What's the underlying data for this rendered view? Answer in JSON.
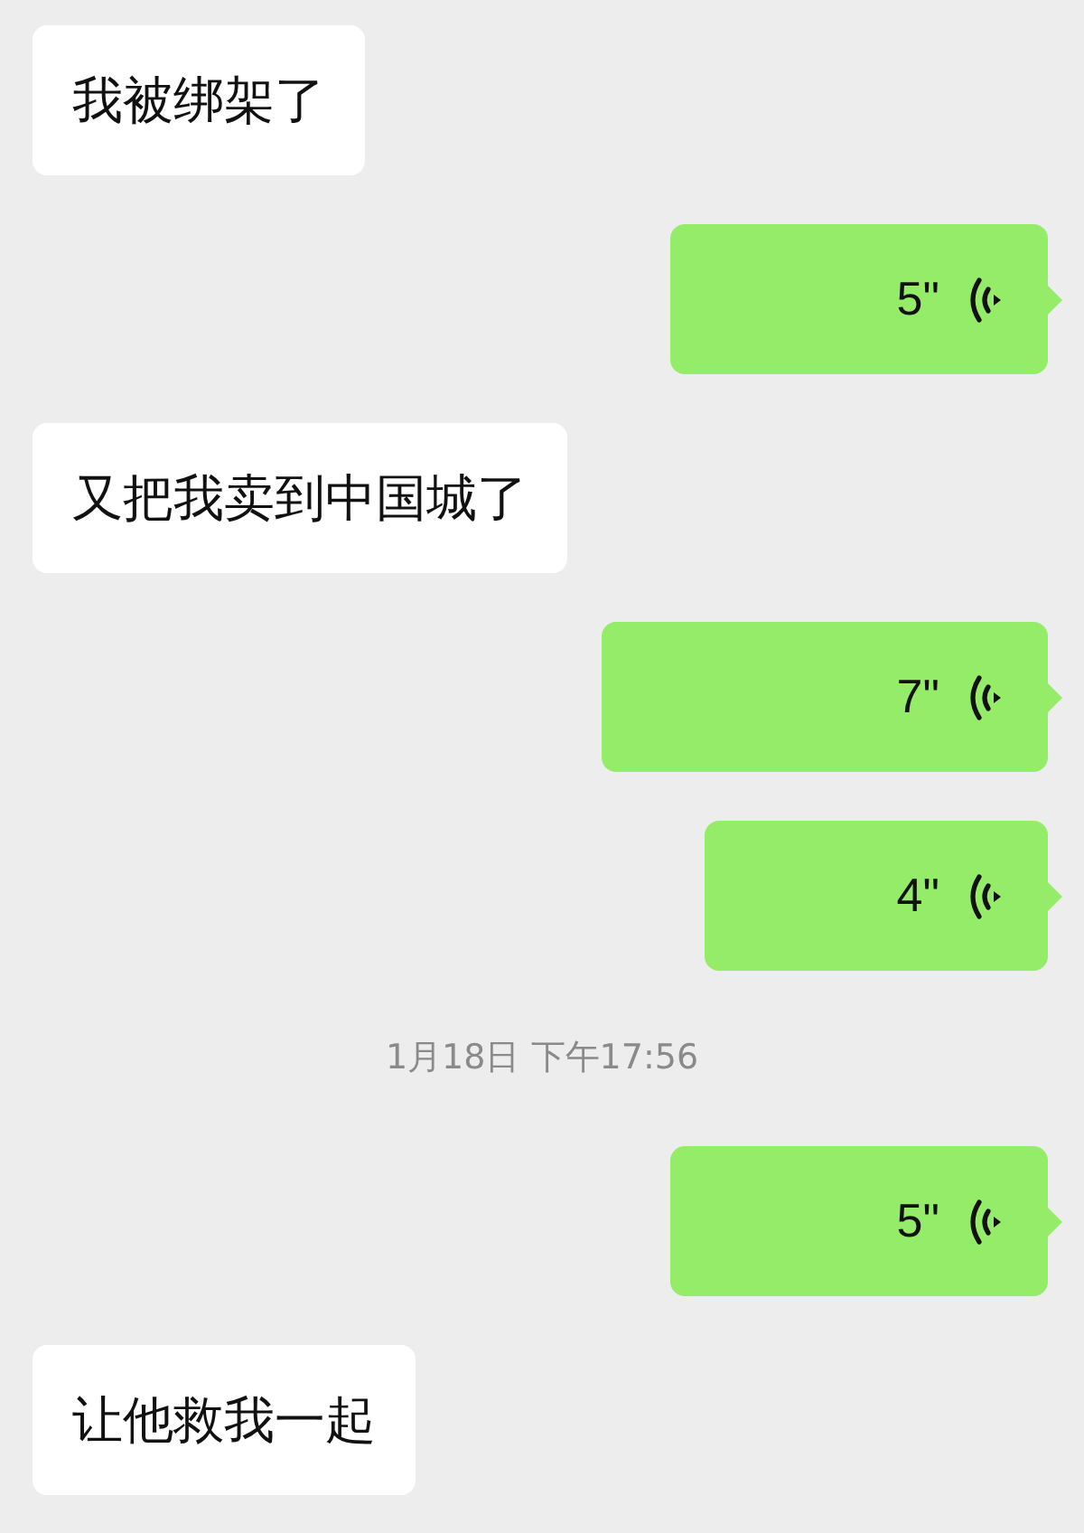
{
  "messages": [
    {
      "kind": "received_text",
      "text": "我被绑架了"
    },
    {
      "kind": "sent_voice",
      "duration": "5\""
    },
    {
      "kind": "received_text",
      "text": "又把我卖到中国城了"
    },
    {
      "kind": "sent_voice",
      "duration": "7\""
    },
    {
      "kind": "sent_voice",
      "duration": "4\""
    },
    {
      "kind": "time",
      "text": "1月18日 下午17:56"
    },
    {
      "kind": "sent_voice",
      "duration": "5\""
    },
    {
      "kind": "received_text",
      "text": "让他救我一起"
    }
  ]
}
